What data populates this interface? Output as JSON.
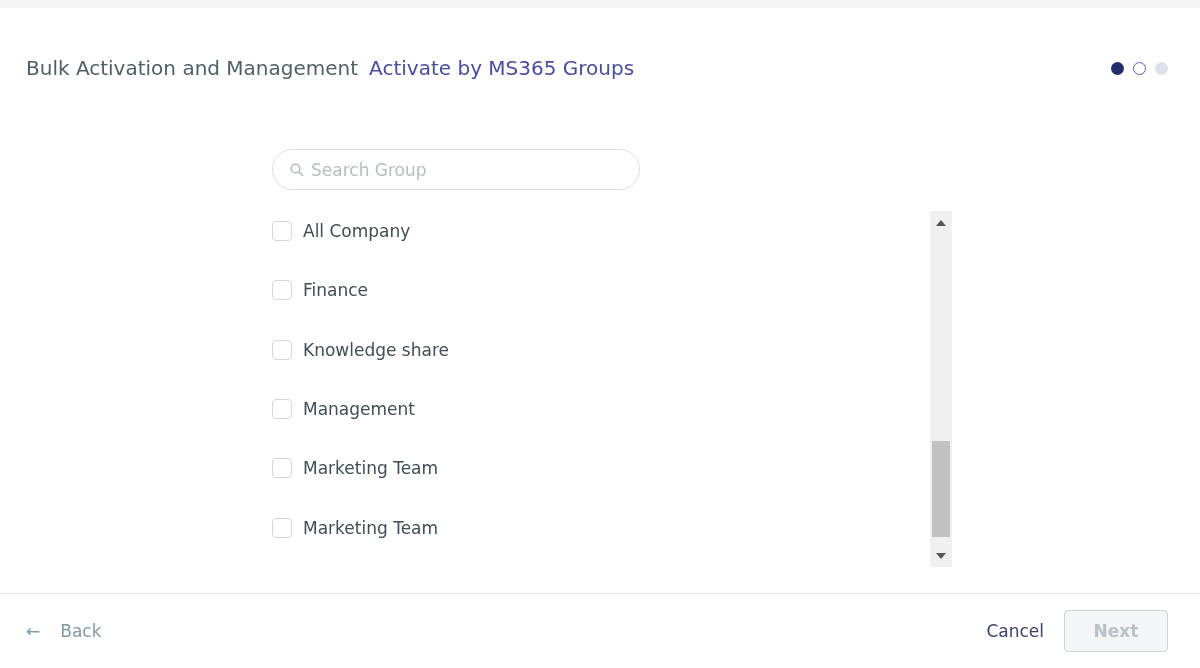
{
  "header": {
    "title": "Bulk Activation and Management",
    "subtitle": "Activate by MS365 Groups",
    "steps": [
      {
        "kind": "filled"
      },
      {
        "kind": "outlined"
      },
      {
        "kind": "faded"
      }
    ]
  },
  "search": {
    "placeholder": "Search Group"
  },
  "groups": [
    {
      "label": "All Company",
      "checked": false
    },
    {
      "label": "Finance",
      "checked": false
    },
    {
      "label": "Knowledge share",
      "checked": false
    },
    {
      "label": "Management",
      "checked": false
    },
    {
      "label": "Marketing Team",
      "checked": false
    },
    {
      "label": "Marketing Team",
      "checked": false
    }
  ],
  "footer": {
    "back": "Back",
    "back_icon": "←",
    "cancel": "Cancel",
    "next": {
      "label": "Next",
      "disabled": true
    }
  }
}
